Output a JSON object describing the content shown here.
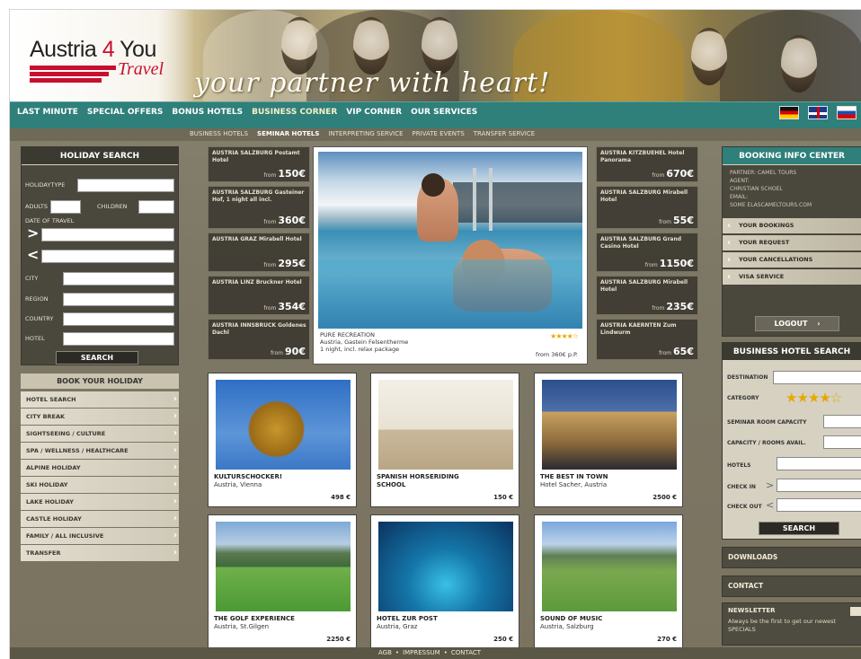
{
  "header": {
    "logo_austria": "Austria",
    "logo_four": "4",
    "logo_you": "You",
    "logo_travel": "Travel",
    "tagline": "your partner with heart!"
  },
  "nav": {
    "items": [
      "LAST MINUTE",
      "SPECIAL OFFERS",
      "BONUS HOTELS",
      "BUSINESS CORNER",
      "VIP CORNER",
      "OUR SERVICES"
    ],
    "active_index": 3,
    "sub_items": [
      "BUSINESS HOTELS",
      "SEMINAR HOTELS",
      "INTERPRETING SERVICE",
      "PRIVATE EVENTS",
      "TRANSFER SERVICE"
    ],
    "sub_active_index": 1,
    "flags": [
      "flag-germany-icon",
      "flag-uk-icon",
      "flag-russia-icon"
    ]
  },
  "holiday_search": {
    "title": "HOLIDAY SEARCH",
    "holiday_type_label": "HOLIDAYTYPE",
    "adults_label": "ADULTS",
    "children_label": "CHILDREN",
    "date_label": "DATE OF TRAVEL",
    "city_label": "CITY",
    "region_label": "REGION",
    "country_label": "COUNTRY",
    "hotel_label": "HOTEL",
    "search_button": "SEARCH"
  },
  "book_holiday": {
    "title": "BOOK YOUR HOLIDAY",
    "items": [
      "HOTEL SEARCH",
      "CITY BREAK",
      "SIGHTSEEING / CULTURE",
      "SPA / WELLNESS / HEALTHCARE",
      "ALPINE HOLIDAY",
      "SKI HOLIDAY",
      "LAKE HOLIDAY",
      "CASTLE HOLIDAY",
      "FAMILY / ALL INCLUSIVE",
      "TRANSFER"
    ]
  },
  "deals_left": [
    {
      "name": "AUSTRIA SALZBURG Postamt Hotel",
      "from": "from",
      "price": "150€"
    },
    {
      "name": "AUSTRIA SALZBURG Gasteiner Hof, 1 night all incl.",
      "from": "from",
      "price": "360€"
    },
    {
      "name": "AUSTRIA GRAZ Mirabell Hotel",
      "from": "from",
      "price": "295€"
    },
    {
      "name": "AUSTRIA LINZ Bruckner Hotel",
      "from": "from",
      "price": "354€"
    },
    {
      "name": "AUSTRIA INNSBRUCK Goldenes Dachl",
      "from": "from",
      "price": "90€"
    }
  ],
  "deals_right": [
    {
      "name": "AUSTRIA KITZBUEHEL Hotel Panorama",
      "from": "from",
      "price": "670€"
    },
    {
      "name": "AUSTRIA SALZBURG Mirabell Hotel",
      "from": "from",
      "price": "55€"
    },
    {
      "name": "AUSTRIA SALZBURG Grand Casino Hotel",
      "from": "from",
      "price": "1150€"
    },
    {
      "name": "AUSTRIA SALZBURG Mirabell Hotel",
      "from": "from",
      "price": "235€"
    },
    {
      "name": "AUSTRIA KAERNTEN Zum Lindwurm",
      "from": "from",
      "price": "65€"
    }
  ],
  "featured": {
    "title": "PURE RECREATION",
    "line1": "Austria, Gastein Felsentherme",
    "line2": "1 night, incl. relax package",
    "price": "from 360€ p.P.",
    "stars": "★★★★☆",
    "rating": 4
  },
  "tiles": [
    {
      "title": "KULTURSCHOCKER!",
      "loc": "Austria, Vienna",
      "loc2": "",
      "price": "498 €"
    },
    {
      "title": "SPANISH HORSERIDING SCHOOL",
      "loc": "",
      "loc2": "",
      "price": "150 €"
    },
    {
      "title": "THE BEST IN TOWN",
      "loc": "Hotel Sacher, Austria",
      "loc2": "",
      "price": "2500 €"
    },
    {
      "title": "THE GOLF EXPERIENCE",
      "loc": "Austria, St.Gilgen",
      "loc2": "",
      "price": "2250 €"
    },
    {
      "title": "HOTEL ZUR POST",
      "loc": "Austria, Graz",
      "loc2": "",
      "price": "250 €"
    },
    {
      "title": "SOUND OF MUSIC",
      "loc": "Austria, Salzburg",
      "loc2": "",
      "price": "270 €"
    }
  ],
  "booking_info": {
    "title": "BOOKING INFO CENTER",
    "lines": [
      "PARTNER: CAMEL TOURS",
      "AGENT:",
      "CHRISTIAN SCHOEL",
      "EMAIL:",
      "SOME ELASCAMELTOURS.COM"
    ],
    "items": [
      "YOUR BOOKINGS",
      "YOUR REQUEST",
      "YOUR CANCELLATIONS",
      "VISA SERVICE"
    ],
    "logout": "LOGOUT"
  },
  "business_search": {
    "title": "BUSINESS HOTEL SEARCH",
    "destination": "DESTINATION",
    "category": "CATEGORY",
    "category_stars": "★★★★☆",
    "seminar": "SEMINAR ROOM CAPACITY",
    "capacity": "CAPACITY / ROOMS AVAIL.",
    "hotels": "HOTELS",
    "checkin": "CHECK IN",
    "checkout": "CHECK OUT",
    "search_button": "SEARCH"
  },
  "sidebar_links": {
    "downloads": "DOWNLOADS",
    "contact": "CONTACT",
    "newsletter_title": "NEWSLETTER",
    "newsletter_text": "Always be the first to get our newest SPECIALS"
  },
  "footer": {
    "links": [
      "AGB",
      "IMPRESSUM",
      "CONTACT"
    ],
    "sep": "•"
  },
  "colors": {
    "nav_teal": "#2f7f7a",
    "panel_dark": "#4a473d",
    "accent_red": "#c8102e"
  }
}
